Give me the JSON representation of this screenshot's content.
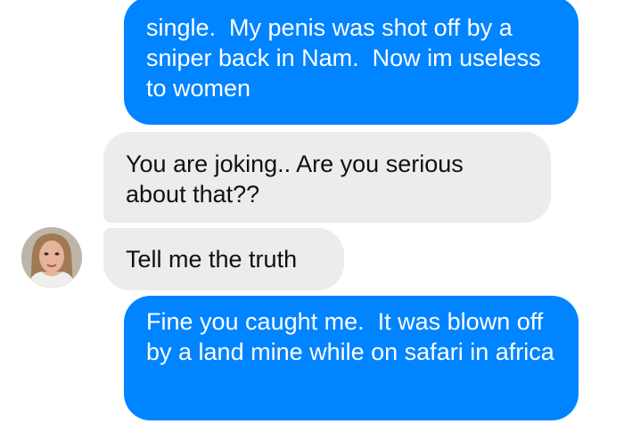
{
  "messages": [
    {
      "direction": "outgoing",
      "text": "single.  My penis was shot off by a sniper back in Nam.  Now im useless to women"
    },
    {
      "direction": "incoming",
      "text": "You are joking.. Are you serious about that??"
    },
    {
      "direction": "incoming",
      "text": "Tell me the truth"
    },
    {
      "direction": "outgoing",
      "text": "Fine you caught me.  It was blown off by a land mine while on safari in africa"
    }
  ],
  "colors": {
    "outgoing_bubble": "#0084ff",
    "incoming_bubble": "#ececec",
    "background": "#ffffff"
  },
  "icons": {
    "contact_avatar": "profile-photo"
  }
}
